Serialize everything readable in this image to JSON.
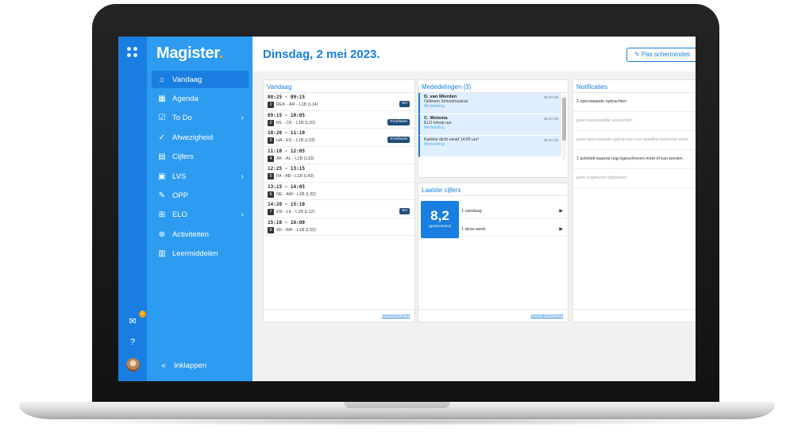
{
  "app": {
    "brand": "Magister",
    "brand_dot": "."
  },
  "page": {
    "title": "Dinsdag, 2 mei 2023.",
    "adjust_button": "Pas schermindeli"
  },
  "rail": {
    "grid_icon": "apps-grid-icon",
    "mail_badge": "1",
    "mail_icon": "mail-icon",
    "help_icon": "help-icon"
  },
  "sidebar": {
    "items": [
      {
        "label": "Vandaag",
        "icon": "home-icon",
        "glyph": "⌂",
        "active": true,
        "chevron": false
      },
      {
        "label": "Agenda",
        "icon": "calendar-icon",
        "glyph": "▦",
        "active": false,
        "chevron": false
      },
      {
        "label": "To Do",
        "icon": "checkbox-icon",
        "glyph": "☑",
        "active": false,
        "chevron": true
      },
      {
        "label": "Afwezigheid",
        "icon": "check-circle-icon",
        "glyph": "✓",
        "active": false,
        "chevron": false
      },
      {
        "label": "Cijfers",
        "icon": "grades-icon",
        "glyph": "▤",
        "active": false,
        "chevron": false
      },
      {
        "label": "LVS",
        "icon": "student-file-icon",
        "glyph": "▣",
        "active": false,
        "chevron": true
      },
      {
        "label": "OPP",
        "icon": "opp-icon",
        "glyph": "✎",
        "active": false,
        "chevron": false
      },
      {
        "label": "ELO",
        "icon": "elo-icon",
        "glyph": "⊞",
        "active": false,
        "chevron": true
      },
      {
        "label": "Activiteiten",
        "icon": "activities-icon",
        "glyph": "⊕",
        "active": false,
        "chevron": false
      },
      {
        "label": "Leermiddelen",
        "icon": "books-icon",
        "glyph": "▥",
        "active": false,
        "chevron": false
      }
    ],
    "collapse_label": "Inklappen",
    "collapse_glyph": "«"
  },
  "vandaag": {
    "title": "Vandaag",
    "footer_link": "weekoverzicht",
    "lessons": [
      {
        "time": "08:25 - 09:15",
        "num": "1",
        "desc": "REK - AR - L1B (L14)",
        "tag": "SO"
      },
      {
        "time": "09:15 - 10:05",
        "num": "2",
        "desc": "ML - CK - L1B (L20)",
        "tag": "Proefwerk"
      },
      {
        "time": "10:20 - 11:10",
        "num": "3",
        "desc": "HA - ES - L1B (L33)",
        "tag": "Proefwerk"
      },
      {
        "time": "11:10 - 12:05",
        "num": "4",
        "desc": "AK - AL - L1B (L33)",
        "tag": ""
      },
      {
        "time": "12:25 - 13:15",
        "num": "5",
        "desc": "FA - AB - L1B (L42)",
        "tag": ""
      },
      {
        "time": "13:15 - 14:05",
        "num": "6",
        "desc": "NE - AW - L1B (L32)",
        "tag": ""
      },
      {
        "time": "14:20 - 15:10",
        "num": "7",
        "desc": "EN - LE - L1B (L12)",
        "tag": "SO"
      },
      {
        "time": "15:10 - 16:00",
        "num": "8",
        "desc": "WI - WR - L1B (L52)",
        "tag": ""
      }
    ]
  },
  "mededelingen": {
    "title": "Mededelingen (3)",
    "items": [
      {
        "title": "D. van Mierden",
        "text": "Oefenen Schoolmusical",
        "type": "Mededeling",
        "date": "31-07-23"
      },
      {
        "title": "C. Wolsma",
        "text": "ELO inloop uur",
        "type": "Mededeling",
        "date": "31-07-23"
      },
      {
        "title": "",
        "text": "Kantine dicht vanaf 14:00 uur!",
        "type": "Mededeling",
        "date": "31-07-23"
      }
    ]
  },
  "cijfers": {
    "title": "Laatste cijfers",
    "grade": "8,2",
    "grade_sub": "gecheckeerd",
    "rows": [
      "1 vandaag",
      "1 deze week"
    ],
    "footer_link": "periodeoverzicht"
  },
  "notificaties": {
    "title": "Notificaties",
    "items": [
      {
        "text": "2 openstaande opdrachten",
        "muted": false
      },
      {
        "text": "geen beoordeelde opdrachten",
        "muted": true
      },
      {
        "text": "geen openstaande opdrachten met deadline komende week",
        "muted": true
      },
      {
        "text": "1 activiteit waarop nog ingeschreven moet of kan worden",
        "muted": false
      },
      {
        "text": "geen ongelezen logboeken",
        "muted": true
      }
    ]
  }
}
